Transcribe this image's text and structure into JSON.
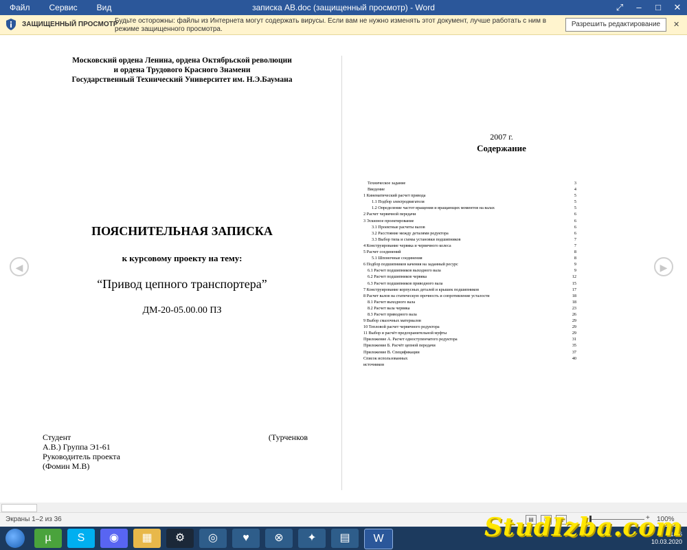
{
  "window": {
    "menu": [
      "Файл",
      "Сервис",
      "Вид"
    ],
    "title": "записка АВ.doc (защищенный просмотр) - Word"
  },
  "protected_view": {
    "label": "ЗАЩИЩЕННЫЙ ПРОСМОТР",
    "message": "Будьте осторожны: файлы из Интернета могут содержать вирусы. Если вам не нужно изменять этот документ, лучше работать с ним в режиме защищенного просмотра.",
    "button": "Разрешить редактирование"
  },
  "page1": {
    "university_line1": "Московский ордена Ленина, ордена Октябрьской революции",
    "university_line2": "и ордена Трудового Красного Знамени",
    "university_line3": "Государственный Технический Университет им. Н.Э.Баумана",
    "title": "ПОЯСНИТЕЛЬНАЯ ЗАПИСКА",
    "subtitle": "к курсовому проекту на тему:",
    "topic": "“Привод цепного транспортера”",
    "code": "ДМ-20-05.00.00 ПЗ",
    "student_label": "Студент",
    "student_name_start": "(Турченков",
    "student_line2": "А.В.) Группа Э1-61",
    "supervisor_label": "Руководитель проекта",
    "supervisor_name": "(Фомин М.В)"
  },
  "page2": {
    "year": "2007 г.",
    "contents_title": "Содержание",
    "toc": [
      {
        "indent": 1,
        "text": "Техническое задание",
        "page": "3"
      },
      {
        "indent": 1,
        "text": "Введение",
        "page": "4"
      },
      {
        "indent": 0,
        "text": "1 Кинематический расчет привода",
        "page": "5"
      },
      {
        "indent": 2,
        "text": "1.1 Подбор электродвигателя",
        "page": "5"
      },
      {
        "indent": 2,
        "text": "1.2 Определение частот вращения и вращающих моментов на валах",
        "page": "5"
      },
      {
        "indent": 0,
        "text": "2 Расчет червячной передачи",
        "page": "6"
      },
      {
        "indent": 0,
        "text": "3 Эскизное проектирование",
        "page": "6"
      },
      {
        "indent": 2,
        "text": "3.1 Проектные расчеты валов",
        "page": "6"
      },
      {
        "indent": 2,
        "text": "3.2 Расстояние между деталями редуктора",
        "page": "6"
      },
      {
        "indent": 2,
        "text": "3.3 Выбор типа и схемы установки подшипников",
        "page": "7"
      },
      {
        "indent": 0,
        "text": "4 Конструирование червяка и червячного колеса",
        "page": "7"
      },
      {
        "indent": 0,
        "text": "5 Расчет соединений",
        "page": "8"
      },
      {
        "indent": 2,
        "text": "5.1 Шпоночные соединения",
        "page": "8"
      },
      {
        "indent": 0,
        "text": "6 Подбор подшипников качения на заданный ресурс",
        "page": "9"
      },
      {
        "indent": 1,
        "text": "6.1 Расчет подшипников выходного вала",
        "page": "9"
      },
      {
        "indent": 1,
        "text": "6.2 Расчет подшипников червяка",
        "page": "12"
      },
      {
        "indent": 1,
        "text": "6.3 Расчет подшипников приводного вала",
        "page": "15"
      },
      {
        "indent": 0,
        "text": "7 Конструирование корпусных деталей и крышек подшипников",
        "page": "17"
      },
      {
        "indent": 0,
        "text": "8 Расчет валов на статическую прочность и сопротивление усталости",
        "page": "18"
      },
      {
        "indent": 1,
        "text": "8.1 Расчет выходного вала",
        "page": "18"
      },
      {
        "indent": 1,
        "text": "8.2 Расчет вала червяка",
        "page": "23"
      },
      {
        "indent": 1,
        "text": "8.3 Расчет приводного вала",
        "page": "26"
      },
      {
        "indent": 0,
        "text": "9 Выбор смазочных материалов",
        "page": "29"
      },
      {
        "indent": 0,
        "text": "10 Тепловой расчет червячного редуктора",
        "page": "29"
      },
      {
        "indent": 0,
        "text": "11 Выбор и расчёт предохранительной муфты",
        "page": "29"
      },
      {
        "indent": 0,
        "text": "Приложение А. Расчет одноступенчатого редуктора",
        "page": "31"
      },
      {
        "indent": 0,
        "text": "Приложение Б. Расчёт цепной передачи",
        "page": "35"
      },
      {
        "indent": 0,
        "text": "Приложение В. Спецификации",
        "page": "37"
      },
      {
        "indent": 0,
        "text": "Список использованных",
        "page": "40"
      },
      {
        "indent": 0,
        "text": "источников",
        "page": ""
      }
    ]
  },
  "status": {
    "pages": "Экраны 1–2 из 36",
    "zoom_minus": "-",
    "zoom_plus": "+",
    "zoom": "100%"
  },
  "taskbar": {
    "time": "21:46",
    "date": "10.03.2020"
  },
  "watermark": "StudIzba.com"
}
